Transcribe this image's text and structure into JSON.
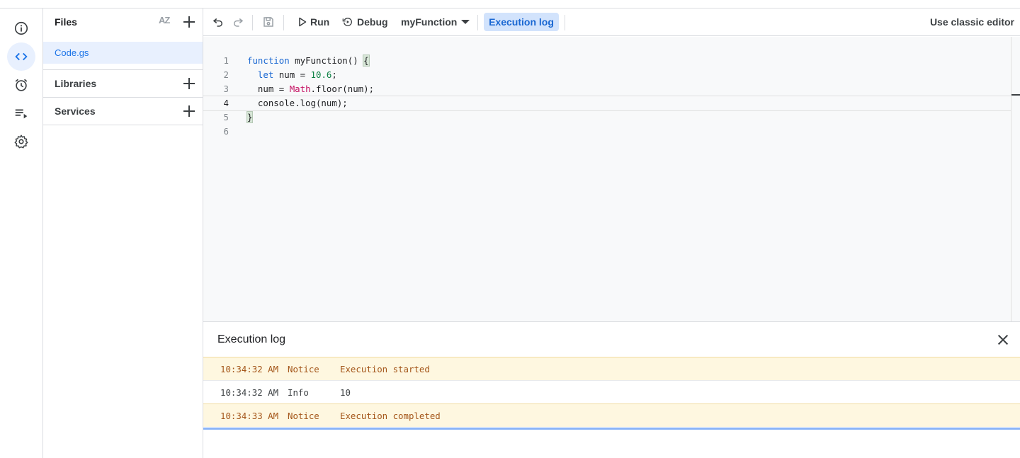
{
  "files_panel": {
    "title": "Files",
    "sort_icon_text": "AZ",
    "files": [
      {
        "name": "Code.gs",
        "selected": true
      }
    ],
    "sections": [
      {
        "label": "Libraries"
      },
      {
        "label": "Services"
      }
    ]
  },
  "toolbar": {
    "run_label": "Run",
    "debug_label": "Debug",
    "function_select": "myFunction",
    "execution_log_label": "Execution log",
    "classic_editor_label": "Use classic editor"
  },
  "editor": {
    "current_line": 4,
    "lines": [
      {
        "n": "1",
        "text": "function myFunction() {"
      },
      {
        "n": "2",
        "text": "  let num = 10.6;"
      },
      {
        "n": "3",
        "text": "  num = Math.floor(num);"
      },
      {
        "n": "4",
        "text": "  console.log(num);"
      },
      {
        "n": "5",
        "text": "}"
      },
      {
        "n": "6",
        "text": ""
      }
    ]
  },
  "execution_log": {
    "title": "Execution log",
    "rows": [
      {
        "time": "10:34:32 AM",
        "severity": "Notice",
        "message": "Execution started"
      },
      {
        "time": "10:34:32 AM",
        "severity": "Info",
        "message": "10"
      },
      {
        "time": "10:34:33 AM",
        "severity": "Notice",
        "message": "Execution completed"
      }
    ]
  },
  "colors": {
    "accent": "#1a73e8",
    "selected_bg": "#e8f0fe",
    "notice_bg": "#fef7e0",
    "notice_text": "#a4561a"
  },
  "icons": {
    "rail": [
      "info-icon",
      "code-icon",
      "alarm-clock-icon",
      "playlist-play-icon",
      "gear-icon"
    ],
    "toolbar": [
      "undo-icon",
      "redo-icon",
      "save-icon",
      "play-icon",
      "debug-icon",
      "chevron-down-icon"
    ]
  }
}
